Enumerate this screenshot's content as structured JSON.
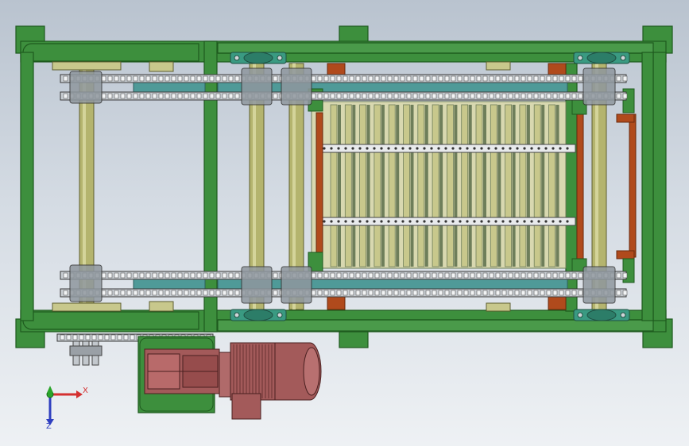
{
  "viewport": {
    "background_top": "#b9c3cf",
    "background_bottom": "#eef1f4"
  },
  "colors": {
    "frame_green": "#3d8f3d",
    "frame_green_dark": "#1e5a1e",
    "roller_shaft": "#b4b46e",
    "slat_yellow": "#c8c88c",
    "slat_dark": "#6e7e5a",
    "chain_steel": "#b9bec3",
    "teal_guide": "#4f9a98",
    "rust_bracket": "#b04a1c",
    "motor_maroon": "#a35a5a",
    "bearing_teal": "#3a9a82"
  },
  "triad": {
    "x_label": "X",
    "z_label": "Z",
    "x_color": "#d43030",
    "y_color": "#2aa52a",
    "z_color": "#2f3fc0"
  },
  "icons": [
    "frame-icon",
    "roller-icon",
    "chain-icon",
    "motor-icon",
    "gearbox-icon",
    "triad-icon"
  ]
}
